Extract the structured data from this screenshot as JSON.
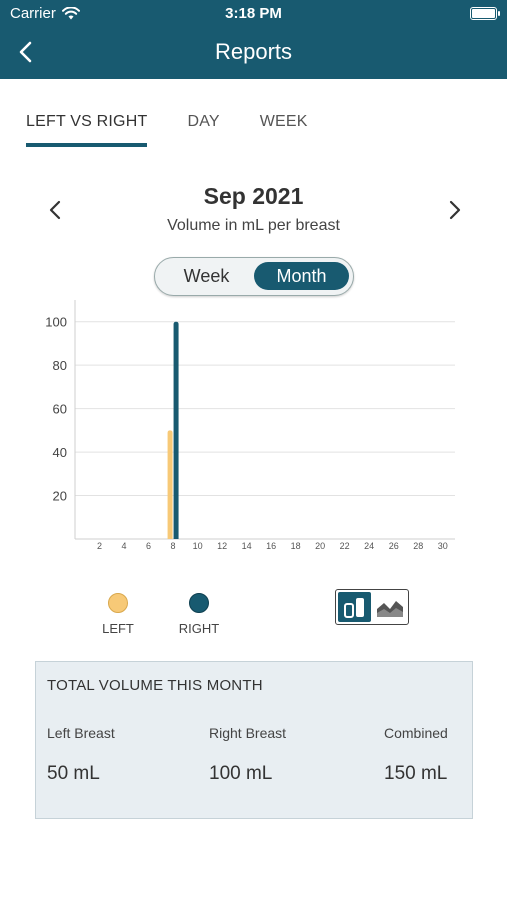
{
  "status_bar": {
    "carrier": "Carrier",
    "time": "3:18 PM"
  },
  "header": {
    "title": "Reports"
  },
  "tabs": [
    {
      "label": "LEFT VS RIGHT",
      "active": true
    },
    {
      "label": "DAY",
      "active": false
    },
    {
      "label": "WEEK",
      "active": false
    }
  ],
  "period": {
    "month": "Sep 2021",
    "subtitle": "Volume in mL per breast"
  },
  "range_toggle": {
    "week": "Week",
    "month": "Month",
    "selected": "Month"
  },
  "chart_data": {
    "type": "bar",
    "x_ticks": [
      "2",
      "4",
      "6",
      "8",
      "10",
      "12",
      "14",
      "16",
      "18",
      "20",
      "22",
      "24",
      "26",
      "28",
      "30"
    ],
    "y_ticks": [
      "20",
      "40",
      "60",
      "80",
      "100"
    ],
    "ylim": [
      0,
      110
    ],
    "xlim": [
      0,
      31
    ],
    "grid": true,
    "series": [
      {
        "name": "LEFT",
        "color": "#f7c977",
        "points": [
          {
            "x": 8,
            "y": 50
          }
        ]
      },
      {
        "name": "RIGHT",
        "color": "#185a70",
        "points": [
          {
            "x": 8,
            "y": 100
          }
        ]
      }
    ]
  },
  "legend": {
    "left": "LEFT",
    "right": "RIGHT"
  },
  "chart_type_toggle": {
    "selected": "bar",
    "options": [
      "bar-chart-icon",
      "area-chart-icon"
    ]
  },
  "summary": {
    "heading": "TOTAL VOLUME THIS MONTH",
    "left_label": "Left Breast",
    "left_value": "50 mL",
    "right_label": "Right Breast",
    "right_value": "100 mL",
    "combined_label": "Combined",
    "combined_value": "150 mL"
  }
}
